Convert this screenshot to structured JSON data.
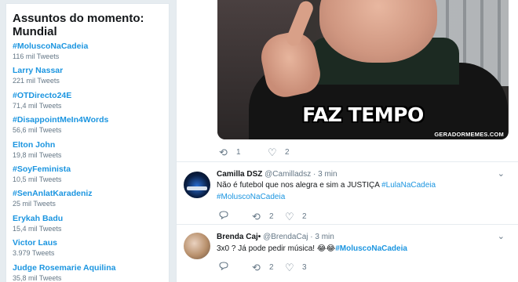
{
  "trends": {
    "title_line1": "Assuntos do momento:",
    "title_line2": "Mundial",
    "items": [
      {
        "name": "#MoluscoNaCadeia",
        "count": "116 mil Tweets"
      },
      {
        "name": "Larry Nassar",
        "count": "221 mil Tweets"
      },
      {
        "name": "#OTDirecto24E",
        "count": "71,4 mil Tweets"
      },
      {
        "name": "#DisappointMeIn4Words",
        "count": "56,6 mil Tweets"
      },
      {
        "name": "Elton John",
        "count": "19,8 mil Tweets"
      },
      {
        "name": "#SoyFeminista",
        "count": "10,5 mil Tweets"
      },
      {
        "name": "#SenAnlatKaradeniz",
        "count": "25 mil Tweets"
      },
      {
        "name": "Erykah Badu",
        "count": "15,4 mil Tweets"
      },
      {
        "name": "Victor Laus",
        "count": "3.979 Tweets"
      },
      {
        "name": "Judge Rosemarie Aquilina",
        "count": "35,8 mil Tweets"
      }
    ]
  },
  "meme": {
    "caption": "FAZ TEMPO",
    "watermark": "GERADORMEMES.COM",
    "retweets": "1",
    "likes": "2"
  },
  "tweets": [
    {
      "name": "Camilla DSZ",
      "handle": "@Camilladsz",
      "dot": "·",
      "time": "3 min",
      "text_plain": "Não é futebol que nos alegra e sim a JUSTIÇA",
      "tag1": "#LulaNaCadeia",
      "tag2": "#MoluscoNaCadeia",
      "retweets": "2",
      "likes": "2"
    },
    {
      "name": "Brenda Caj•",
      "handle": "@BrendaCaj",
      "dot": "·",
      "time": "3 min",
      "text_plain": "3x0 ? Já pode pedir música!",
      "emojis": "😂😂",
      "tag1": "#MoluscoNaCadeia",
      "retweets": "2",
      "likes": "3"
    }
  ],
  "icons": {
    "reply": "speech-bubble",
    "retweet": "⟲",
    "like": "♡",
    "caret": "⌄"
  },
  "colors": {
    "link": "#1b95e0",
    "muted": "#657786",
    "background": "#e6ecf0"
  }
}
